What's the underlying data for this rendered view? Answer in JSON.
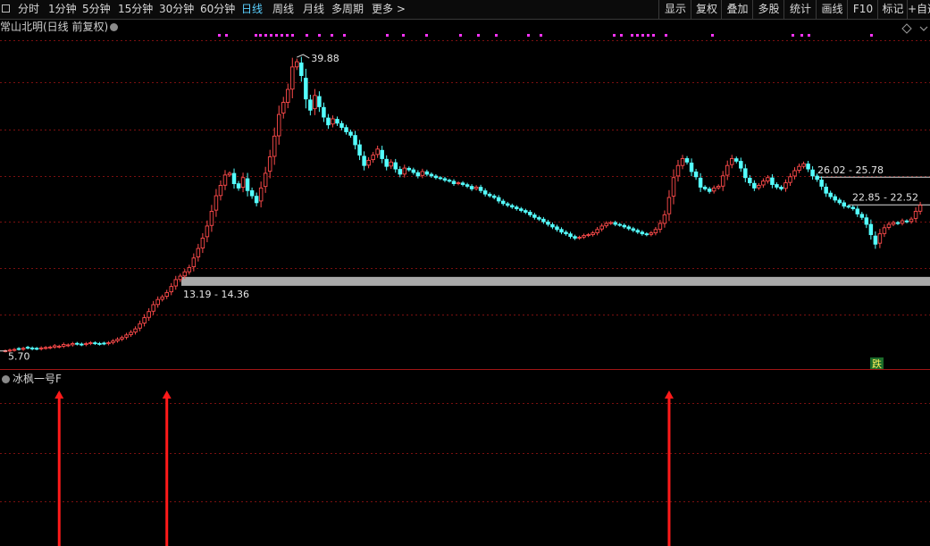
{
  "toolbar": {
    "periods": [
      "分时",
      "1分钟",
      "5分钟",
      "15分钟",
      "30分钟",
      "60分钟",
      "日线",
      "周线",
      "月线",
      "多周期",
      "更多 >"
    ],
    "active_period": "日线",
    "right_buttons": [
      "显示",
      "复权",
      "叠加",
      "多股",
      "统计",
      "画线",
      "F10",
      "标记",
      "+自选"
    ]
  },
  "chart": {
    "title": "常山北明(日线 前复权)",
    "max_label": "39.88",
    "min_label": "5.70",
    "zones": [
      {
        "label": "26.02 - 25.78",
        "y": 25.9
      },
      {
        "label": "22.85 - 22.52",
        "y": 22.7
      },
      {
        "label": "13.19 - 14.36",
        "y": 13.8
      }
    ],
    "signal_label": "跌",
    "colors": {
      "up": "#ff4b4b",
      "down": "#54ffff",
      "grid": "#7a1010",
      "dots": "#ff33ff",
      "arrow": "#ff1a1a"
    }
  },
  "indicator": {
    "name": "冰枫一号F",
    "arrows_at_candle": [
      12,
      36,
      148
    ]
  },
  "chart_data": {
    "type": "candlestick",
    "ylim": [
      5.0,
      42.0
    ],
    "candle_count": 207,
    "close": [
      5.78,
      5.85,
      5.92,
      5.95,
      6.05,
      6.1,
      6.0,
      5.98,
      6.1,
      6.15,
      6.2,
      6.35,
      6.3,
      6.5,
      6.45,
      6.6,
      6.55,
      6.48,
      6.6,
      6.7,
      6.62,
      6.55,
      6.58,
      6.7,
      6.9,
      7.1,
      7.3,
      7.6,
      7.9,
      8.3,
      8.9,
      9.6,
      10.3,
      11.1,
      11.7,
      12.0,
      12.5,
      13.2,
      14.0,
      14.4,
      14.9,
      15.4,
      16.5,
      17.6,
      18.8,
      20.2,
      21.9,
      23.7,
      24.9,
      26.1,
      26.3,
      25.1,
      24.6,
      25.8,
      24.3,
      23.7,
      22.9,
      24.6,
      26.3,
      28.2,
      30.6,
      33.1,
      34.5,
      36.0,
      38.6,
      39.2,
      37.6,
      34.9,
      33.6,
      35.3,
      34.0,
      32.8,
      31.9,
      32.6,
      32.1,
      31.6,
      31.1,
      30.7,
      29.6,
      28.4,
      27.2,
      27.8,
      28.4,
      29.1,
      28.0,
      27.1,
      27.6,
      26.8,
      26.2,
      26.9,
      26.7,
      26.4,
      26.0,
      26.5,
      26.2,
      26.0,
      25.8,
      25.7,
      25.5,
      25.4,
      25.1,
      25.2,
      25.0,
      24.8,
      24.5,
      24.7,
      24.3,
      23.9,
      23.7,
      23.5,
      23.1,
      22.8,
      22.6,
      22.4,
      22.2,
      22.0,
      21.8,
      21.5,
      21.2,
      21.0,
      20.7,
      20.4,
      20.1,
      19.8,
      19.5,
      19.3,
      19.0,
      18.8,
      18.9,
      19.1,
      19.2,
      19.4,
      19.8,
      20.2,
      20.5,
      20.6,
      20.4,
      20.3,
      20.1,
      19.9,
      19.7,
      19.5,
      19.3,
      19.2,
      19.4,
      19.8,
      20.5,
      21.5,
      23.5,
      25.8,
      27.2,
      28.0,
      27.6,
      26.5,
      25.9,
      24.7,
      24.5,
      24.2,
      24.6,
      24.8,
      26.0,
      27.2,
      28.0,
      27.7,
      26.9,
      25.8,
      25.2,
      24.6,
      24.9,
      25.4,
      25.8,
      25.0,
      24.7,
      24.5,
      25.2,
      25.9,
      26.6,
      27.1,
      27.4,
      26.8,
      26.0,
      25.6,
      24.8,
      24.0,
      23.6,
      23.2,
      22.9,
      22.5,
      22.4,
      22.2,
      21.6,
      21.2,
      20.4,
      19.2,
      18.1,
      19.3,
      20.0,
      20.4,
      20.6,
      20.5,
      20.8,
      20.7,
      21.0,
      21.9,
      22.6
    ]
  }
}
